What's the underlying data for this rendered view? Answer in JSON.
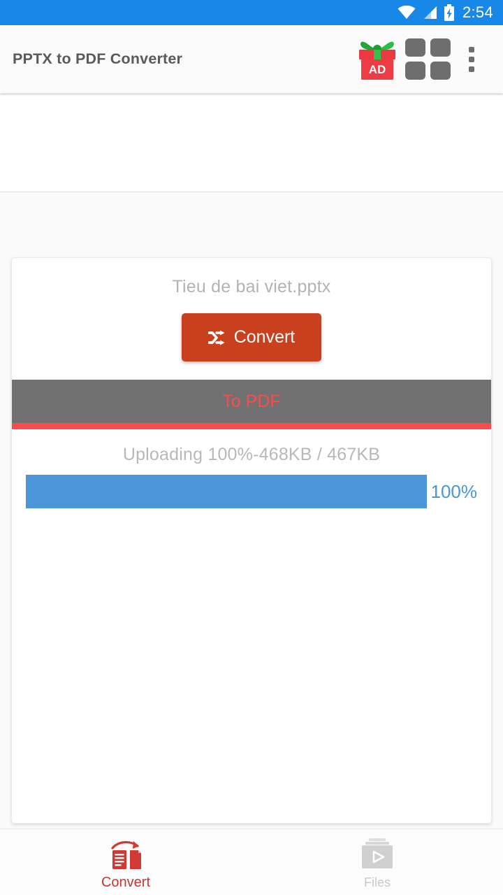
{
  "statusbar": {
    "time": "2:54",
    "icons": [
      "wifi-icon",
      "cellular-signal-icon",
      "battery-charging-icon"
    ],
    "background_color": "#1787e8"
  },
  "appbar": {
    "title": "PPTX to PDF Converter",
    "background_color": "#fbfbfb",
    "title_color": "#5a5a5a",
    "actions": [
      {
        "name": "gift-ad-button",
        "label": "AD",
        "icon": "gift-box-icon"
      },
      {
        "name": "apps-grid-button",
        "icon": "grid-icon"
      },
      {
        "name": "overflow-menu-button",
        "icon": "more-vertical-icon"
      }
    ]
  },
  "ad_banner": {
    "present": true,
    "content": ""
  },
  "card": {
    "filename": "Tieu de bai viet.pptx",
    "convert_button": {
      "label": "Convert",
      "icon": "shuffle-icon",
      "color": "#c8401e"
    },
    "format_spinner": {
      "selected": "To PDF",
      "text_color": "#fb4c4c",
      "background_color": "#717171",
      "underline_color": "#fb4c4c"
    },
    "upload_status": "Uploading 100%-468KB / 467KB",
    "progress": {
      "percent": 100,
      "label": "100%",
      "fill_color": "#4a96d9"
    }
  },
  "bottomnav": {
    "items": [
      {
        "label": "Convert",
        "icon": "document-convert-icon",
        "active": true,
        "color": "#d0332f"
      },
      {
        "label": "Files",
        "icon": "folder-play-icon",
        "active": false,
        "color": "#c9c9c9"
      }
    ]
  }
}
